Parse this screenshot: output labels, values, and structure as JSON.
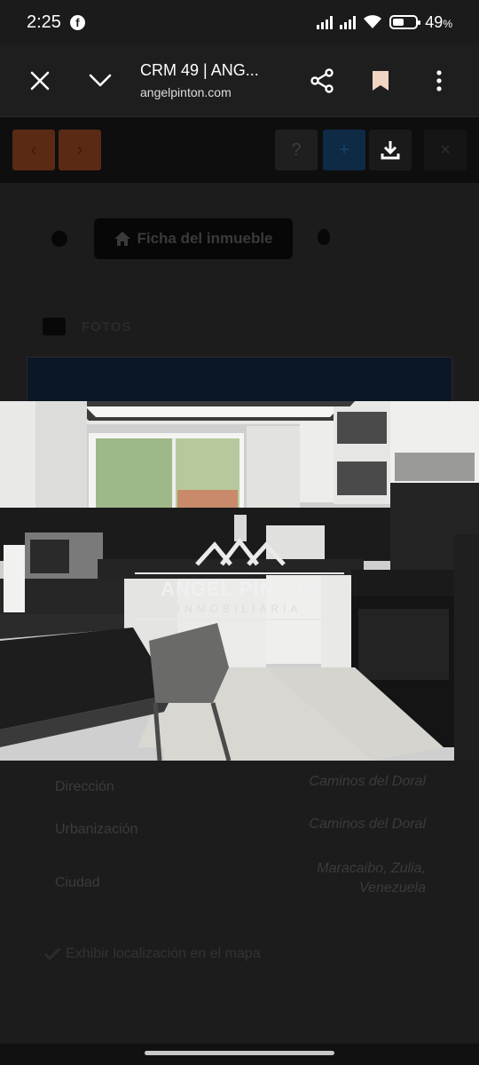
{
  "status": {
    "time": "2:25",
    "battery_text": "49",
    "battery_unit": "%",
    "battery_level": 0.49
  },
  "browser": {
    "title": "CRM 49 | ANG...",
    "host": "angelpinton.com"
  },
  "page": {
    "ficha_label": "Ficha del inmueble",
    "fotos_label": "FOTOS",
    "watermark_name": "ANGEL PINTON",
    "watermark_sub": "INMOBILIARIA",
    "details": [
      {
        "label": "Dirección",
        "value": "Caminos del Doral"
      },
      {
        "label": "Urbanización",
        "value": "Caminos del Doral"
      },
      {
        "label": "Ciudad",
        "value": "Maracaibo, Zulia, Venezuela"
      }
    ],
    "location_label": "Exhibir localización en el mapa"
  }
}
